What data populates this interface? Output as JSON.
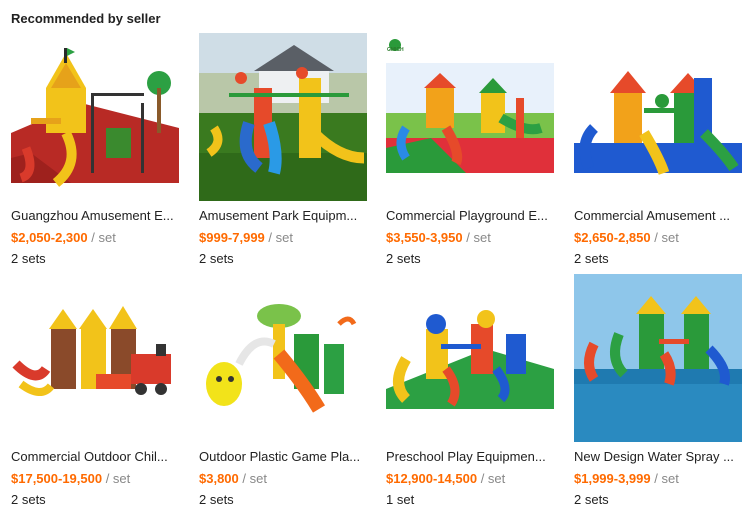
{
  "section": {
    "title": "Recommended by seller"
  },
  "colors": {
    "price": "#ff6a00",
    "text": "#222222",
    "muted": "#888888"
  },
  "products": [
    {
      "title": "Guangzhou Amusement E...",
      "price": "$2,050-2,300",
      "unit": " / set",
      "moq": "2 sets",
      "image": "playground-red-floor"
    },
    {
      "title": "Amusement Park Equipm...",
      "price": "$999-7,999",
      "unit": " / set",
      "moq": "2 sets",
      "image": "playground-grass-house"
    },
    {
      "title": "Commercial Playground E...",
      "price": "$3,550-3,950",
      "unit": " / set",
      "moq": "2 sets",
      "image": "playground-colorful-floor",
      "logo": "GMICH"
    },
    {
      "title": "Commercial Amusement ...",
      "price": "$2,650-2,850",
      "unit": " / set",
      "moq": "2 sets",
      "image": "playground-blue-floor"
    },
    {
      "title": "Commercial Outdoor Chil...",
      "price": "$17,500-19,500",
      "unit": " / set",
      "moq": "2 sets",
      "image": "playground-train-castle"
    },
    {
      "title": "Outdoor Plastic Game Pla...",
      "price": "$3,800",
      "unit": " / set",
      "moq": "2 sets",
      "image": "playground-bee-mushroom"
    },
    {
      "title": "Preschool Play Equipmen...",
      "price": "$12,900-14,500",
      "unit": " / set",
      "moq": "1 set",
      "image": "playground-green-floor"
    },
    {
      "title": "New Design Water Spray ...",
      "price": "$1,999-3,999",
      "unit": " / set",
      "moq": "2 sets",
      "image": "playground-water-park"
    }
  ]
}
